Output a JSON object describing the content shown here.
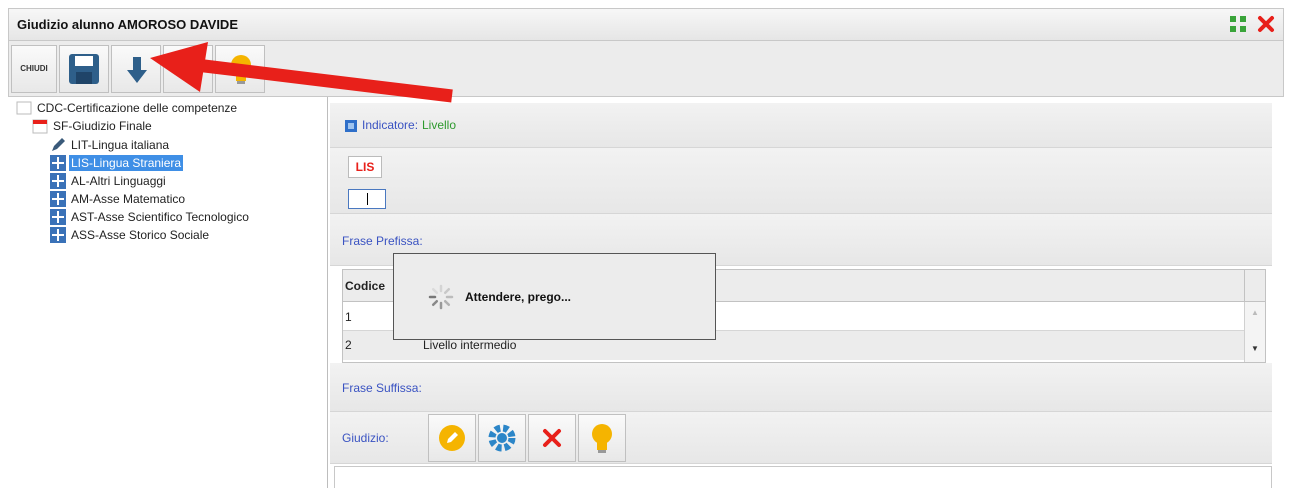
{
  "window": {
    "title": "Giudizio alunno AMOROSO DAVIDE"
  },
  "toolbar": {
    "close_label": "CHIUDI"
  },
  "tree": {
    "root": "CDC-Certificazione delle competenze",
    "child": "SF-Giudizio Finale",
    "items": [
      {
        "label": "LIT-Lingua italiana",
        "icon": "pencil-icon",
        "selected": false
      },
      {
        "label": "LIS-Lingua Straniera",
        "icon": "grid-icon",
        "selected": true
      },
      {
        "label": "AL-Altri Linguaggi",
        "icon": "grid-icon",
        "selected": false
      },
      {
        "label": "AM-Asse Matematico",
        "icon": "grid-icon",
        "selected": false
      },
      {
        "label": "AST-Asse Scientifico Tecnologico",
        "icon": "grid-icon",
        "selected": false
      },
      {
        "label": "ASS-Asse Storico Sociale",
        "icon": "grid-icon",
        "selected": false
      }
    ]
  },
  "main": {
    "indicator_label": "Indicatore:",
    "indicator_value": "Livello",
    "badge": "LIS",
    "prefix_label": "Frase Prefissa:",
    "suffix_label": "Frase Suffissa:",
    "judgment_label": "Giudizio:"
  },
  "table": {
    "headers": [
      "Codice",
      ""
    ],
    "rows": [
      {
        "code": "1",
        "desc": ""
      },
      {
        "code": "2",
        "desc": "Livello intermedio"
      }
    ]
  },
  "loading": {
    "message": "Attendere, prego..."
  },
  "colors": {
    "accent_red": "#e8201a",
    "selection": "#3f8fe6",
    "link_blue": "#3a53c2",
    "green": "#2e9a2e"
  }
}
